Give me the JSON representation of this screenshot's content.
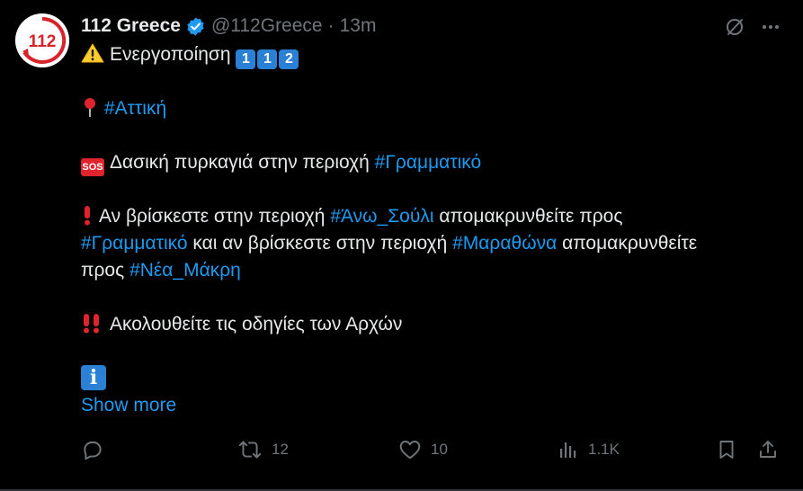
{
  "author": {
    "display_name": "112 Greece",
    "handle": "@112Greece",
    "separator": "·",
    "time": "13m",
    "avatar_text": "112",
    "verified_icon": "verified-badge-icon"
  },
  "tweet": {
    "line1_text": "Ενεργοποίηση",
    "line1_keycaps": [
      "1",
      "1",
      "2"
    ],
    "line2_hashtag": "#Αττική",
    "line3_text": "Δασική πυρκαγιά στην περιοχή ",
    "line3_hashtag": "#Γραμματικό",
    "sos_label": "SOS",
    "line4_text_a": "Αν βρίσκεστε στην περιοχή ",
    "line4_hashtag": "#Άνω_Σούλι",
    "line4_text_b": " απομακρυνθείτε προς",
    "line5_hashtag_a": "#Γραμματικό",
    "line5_text_a": " και αν βρίσκεστε στην περιοχή ",
    "line5_hashtag_b": "#Μαραθώνα",
    "line5_text_b": " απομακρυνθείτε",
    "line6_text": "προς ",
    "line6_hashtag": "#Νέα_Μάκρη",
    "line7_text": "Ακολουθείτε τις οδηγίες των Αρχών",
    "info_label": "i",
    "show_more": "Show more"
  },
  "actions": {
    "reply_count": "",
    "retweet_count": "12",
    "like_count": "10",
    "views_count": "1.1K"
  },
  "colors": {
    "background": "#000000",
    "text": "#e7e9ea",
    "muted": "#71767b",
    "link": "#1d9bf0",
    "verified": "#1d9bf0"
  }
}
